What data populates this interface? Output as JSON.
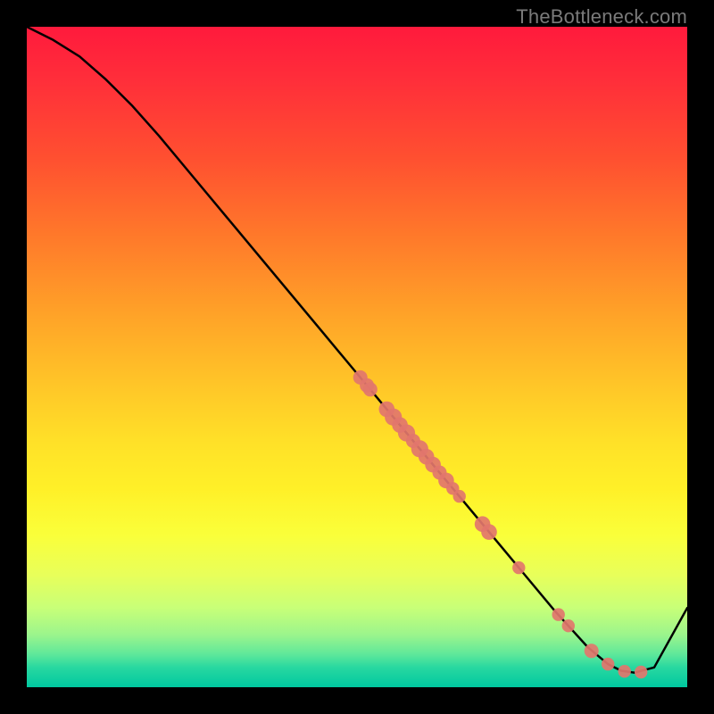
{
  "watermark": "TheBottleneck.com",
  "chart_data": {
    "type": "line",
    "title": "",
    "xlabel": "",
    "ylabel": "",
    "xlim": [
      0,
      1
    ],
    "ylim": [
      0,
      1
    ],
    "note": "Axes are unlabeled in the source image; x and y are normalized 0–1 across the plot area. y=1 is the top edge, y=0 the bottom. The curve is the black line; markers are the salmon dots lying on the curve.",
    "series": [
      {
        "name": "curve",
        "x": [
          0.0,
          0.04,
          0.08,
          0.12,
          0.16,
          0.2,
          0.25,
          0.3,
          0.35,
          0.4,
          0.45,
          0.5,
          0.55,
          0.6,
          0.65,
          0.7,
          0.75,
          0.8,
          0.85,
          0.88,
          0.9,
          0.92,
          0.95,
          1.0
        ],
        "y": [
          1.0,
          0.98,
          0.955,
          0.92,
          0.88,
          0.835,
          0.775,
          0.715,
          0.655,
          0.595,
          0.535,
          0.475,
          0.415,
          0.355,
          0.295,
          0.235,
          0.175,
          0.115,
          0.06,
          0.035,
          0.025,
          0.022,
          0.03,
          0.12
        ]
      }
    ],
    "markers": {
      "name": "points",
      "points": [
        {
          "x": 0.505,
          "y": 0.469,
          "r": 1.0
        },
        {
          "x": 0.515,
          "y": 0.457,
          "r": 1.0
        },
        {
          "x": 0.52,
          "y": 0.451,
          "r": 1.0
        },
        {
          "x": 0.545,
          "y": 0.421,
          "r": 1.1
        },
        {
          "x": 0.555,
          "y": 0.409,
          "r": 1.2
        },
        {
          "x": 0.565,
          "y": 0.397,
          "r": 1.1
        },
        {
          "x": 0.575,
          "y": 0.385,
          "r": 1.2
        },
        {
          "x": 0.585,
          "y": 0.373,
          "r": 1.0
        },
        {
          "x": 0.595,
          "y": 0.361,
          "r": 1.2
        },
        {
          "x": 0.605,
          "y": 0.349,
          "r": 1.1
        },
        {
          "x": 0.615,
          "y": 0.337,
          "r": 1.1
        },
        {
          "x": 0.625,
          "y": 0.325,
          "r": 1.0
        },
        {
          "x": 0.635,
          "y": 0.313,
          "r": 1.1
        },
        {
          "x": 0.645,
          "y": 0.301,
          "r": 0.9
        },
        {
          "x": 0.655,
          "y": 0.289,
          "r": 0.9
        },
        {
          "x": 0.69,
          "y": 0.247,
          "r": 1.1
        },
        {
          "x": 0.7,
          "y": 0.235,
          "r": 1.1
        },
        {
          "x": 0.745,
          "y": 0.181,
          "r": 0.9
        },
        {
          "x": 0.805,
          "y": 0.11,
          "r": 0.9
        },
        {
          "x": 0.82,
          "y": 0.093,
          "r": 0.9
        },
        {
          "x": 0.855,
          "y": 0.055,
          "r": 1.0
        },
        {
          "x": 0.88,
          "y": 0.035,
          "r": 0.9
        },
        {
          "x": 0.905,
          "y": 0.024,
          "r": 0.9
        },
        {
          "x": 0.93,
          "y": 0.023,
          "r": 0.9
        }
      ]
    },
    "background_gradient": {
      "direction": "vertical",
      "stops": [
        {
          "pos": 0.0,
          "color": "#ff1a3c"
        },
        {
          "pos": 0.5,
          "color": "#ffc828"
        },
        {
          "pos": 0.8,
          "color": "#f0ff40"
        },
        {
          "pos": 1.0,
          "color": "#00c8a0"
        }
      ]
    }
  }
}
